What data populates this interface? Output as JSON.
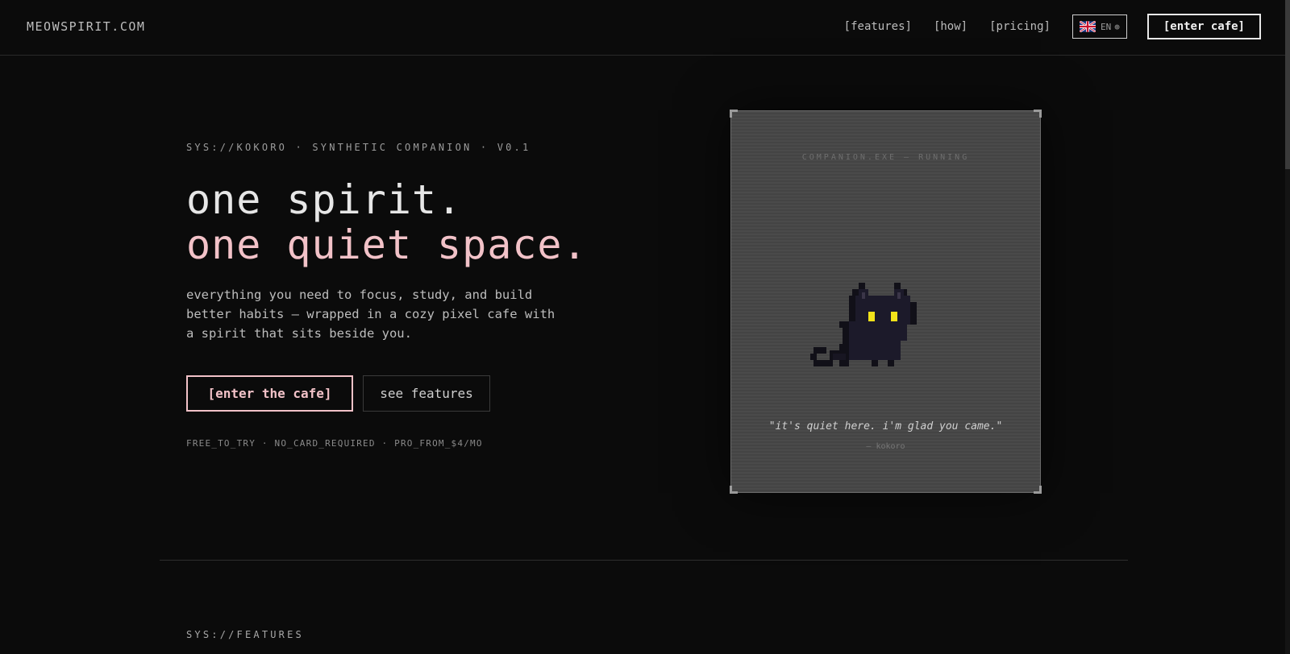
{
  "header": {
    "logo": "MEOWSPIRIT.COM",
    "nav": [
      "[features]",
      "[how]",
      "[pricing]"
    ],
    "language": {
      "code": "EN",
      "flag_icon": "uk-flag-icon",
      "globe_icon": "globe-icon"
    },
    "cta": "[enter cafe]"
  },
  "hero": {
    "sys_tag": "SYS://KOKORO · SYNTHETIC COMPANION · V0.1",
    "headline_line1": "one spirit.",
    "headline_line2": "one quiet space.",
    "description": "everything you need to focus, study, and build better habits — wrapped in a cozy pixel cafe with a spirit that sits beside you.",
    "primary_button": "[enter the cafe]",
    "secondary_button": "see features",
    "fineprint": "FREE_TO_TRY · NO_CARD_REQUIRED · PRO_FROM_$4/MO"
  },
  "companion_card": {
    "status": "COMPANION.EXE — RUNNING",
    "quote": "\"it's quiet here. i'm glad you came.\"",
    "quote_by": "— kokoro"
  },
  "features": {
    "sys_tag": "SYS://FEATURES"
  },
  "colors": {
    "background": "#0b0b0b",
    "accent_pink": "#f2c2c8",
    "card_bg": "#4a4a4a",
    "cat_body": "#1c1a2a",
    "cat_eyes": "#f2e21a"
  }
}
